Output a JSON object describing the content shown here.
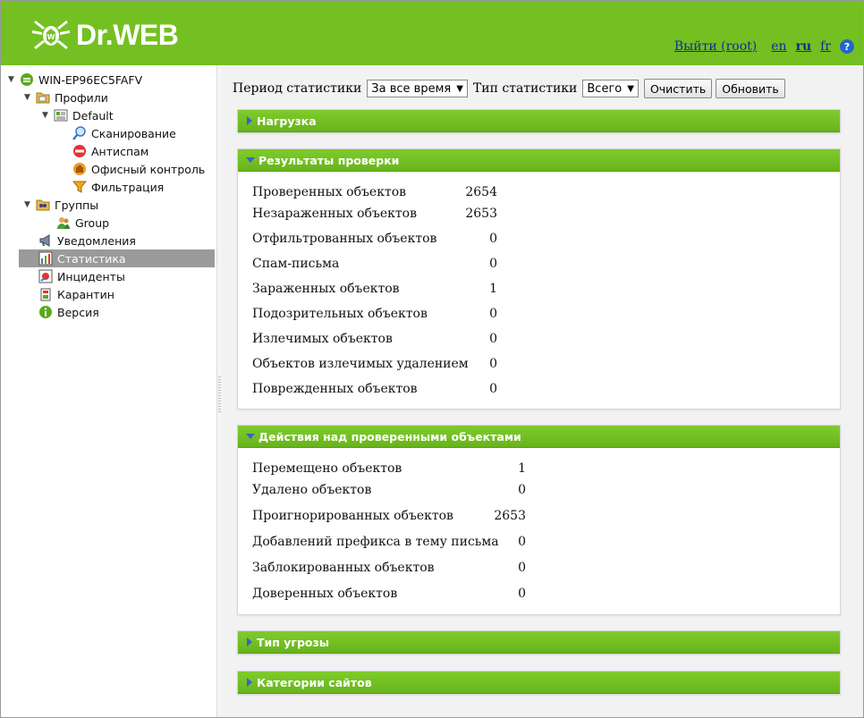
{
  "header": {
    "logo_text": "Dr.WEB",
    "logout": "Выйти (root)",
    "langs": [
      "en",
      "ru",
      "fr"
    ],
    "current_lang": "ru",
    "help": "?"
  },
  "sidebar": {
    "items": [
      {
        "label": "WIN-EP96EC5FAFV",
        "icon": "server-icon"
      },
      {
        "label": "Профили",
        "icon": "folder-icon"
      },
      {
        "label": "Default",
        "icon": "profile-icon"
      },
      {
        "label": "Сканирование",
        "icon": "magnifier-icon"
      },
      {
        "label": "Антиспам",
        "icon": "no-entry-icon"
      },
      {
        "label": "Офисный контроль",
        "icon": "hand-icon"
      },
      {
        "label": "Фильтрация",
        "icon": "funnel-icon"
      },
      {
        "label": "Группы",
        "icon": "group-folder-icon"
      },
      {
        "label": "Group",
        "icon": "users-icon"
      },
      {
        "label": "Уведомления",
        "icon": "megaphone-icon"
      },
      {
        "label": "Статистика",
        "icon": "chart-icon"
      },
      {
        "label": "Инциденты",
        "icon": "incident-icon"
      },
      {
        "label": "Карантин",
        "icon": "quarantine-icon"
      },
      {
        "label": "Версия",
        "icon": "info-icon"
      }
    ],
    "selected": "Статистика"
  },
  "toolbar": {
    "period_label": "Период статистики",
    "period_value": "За все время",
    "type_label": "Тип статистики",
    "type_value": "Всего",
    "clear_button": "Очистить",
    "refresh_button": "Обновить"
  },
  "panels": {
    "load": {
      "title": "Нагрузка",
      "expanded": false
    },
    "scan_results": {
      "title": "Результаты проверки",
      "expanded": true,
      "rows": [
        {
          "label": "Проверенных объектов",
          "value": "2654"
        },
        {
          "label": "Незараженных объектов",
          "value": "2653"
        },
        {
          "label": "Отфильтрованных объектов",
          "value": "0"
        },
        {
          "label": "Спам-письма",
          "value": "0"
        },
        {
          "label": "Зараженных объектов",
          "value": "1"
        },
        {
          "label": "Подозрительных объектов",
          "value": "0"
        },
        {
          "label": "Излечимых объектов",
          "value": "0"
        },
        {
          "label": "Объектов излечимых удалением",
          "value": "0"
        },
        {
          "label": "Поврежденных объектов",
          "value": "0"
        }
      ]
    },
    "actions": {
      "title": "Действия над проверенными объектами",
      "expanded": true,
      "rows": [
        {
          "label": "Перемещено объектов",
          "value": "1"
        },
        {
          "label": "Удалено объектов",
          "value": "0"
        },
        {
          "label": "Проигнорированных объектов",
          "value": "2653"
        },
        {
          "label": "Добавлений префикса в тему письма",
          "value": "0"
        },
        {
          "label": "Заблокированных объектов",
          "value": "0"
        },
        {
          "label": "Доверенных объектов",
          "value": "0"
        }
      ]
    },
    "threat_type": {
      "title": "Тип угрозы",
      "expanded": false
    },
    "site_categories": {
      "title": "Категории сайтов",
      "expanded": false
    }
  },
  "colors": {
    "brand_green": "#74c022",
    "panel_green": "#6fbb22",
    "link_blue": "#0a2f9e"
  }
}
